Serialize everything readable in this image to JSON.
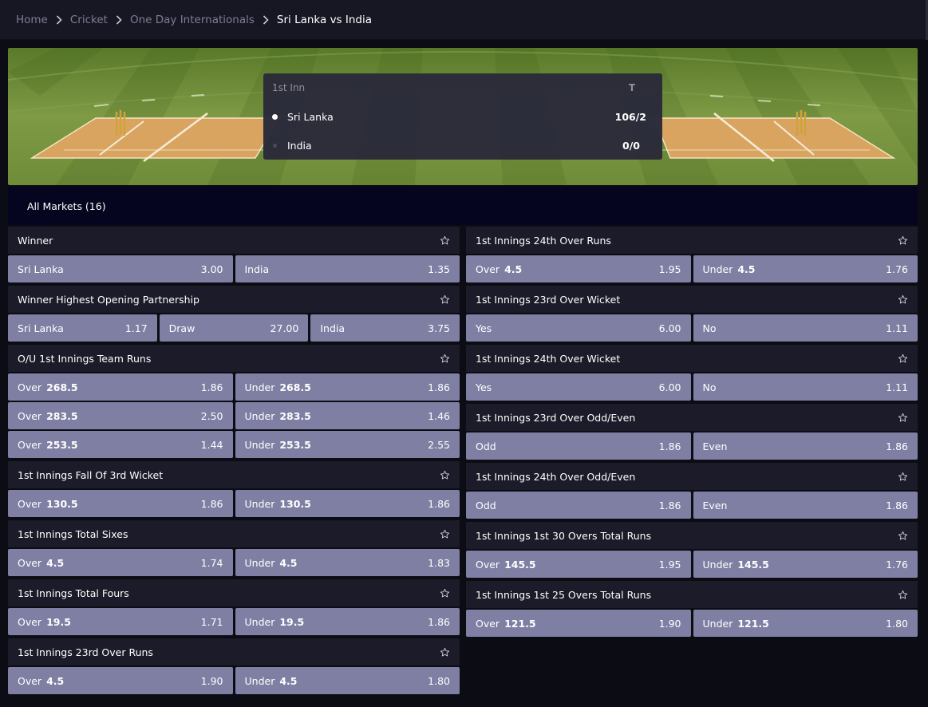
{
  "breadcrumb": {
    "items": [
      "Home",
      "Cricket",
      "One Day Internationals",
      "Sri Lanka vs India"
    ]
  },
  "scoreboard": {
    "innings_label": "1st Inn",
    "total_label": "T",
    "teams": [
      {
        "name": "Sri Lanka",
        "score": "106/2",
        "batting": true
      },
      {
        "name": "India",
        "score": "0/0",
        "batting": false
      }
    ]
  },
  "tabs": {
    "all_markets": "All Markets (16)"
  },
  "markets_left": [
    {
      "title": "Winner",
      "rows": [
        [
          {
            "label": "Sri Lanka",
            "line": "",
            "price": "3.00"
          },
          {
            "label": "India",
            "line": "",
            "price": "1.35"
          }
        ]
      ]
    },
    {
      "title": "Winner Highest Opening Partnership",
      "rows": [
        [
          {
            "label": "Sri Lanka",
            "line": "",
            "price": "1.17"
          },
          {
            "label": "Draw",
            "line": "",
            "price": "27.00"
          },
          {
            "label": "India",
            "line": "",
            "price": "3.75"
          }
        ]
      ]
    },
    {
      "title": "O/U 1st Innings Team Runs",
      "rows": [
        [
          {
            "label": "Over",
            "line": "268.5",
            "price": "1.86"
          },
          {
            "label": "Under",
            "line": "268.5",
            "price": "1.86"
          }
        ],
        [
          {
            "label": "Over",
            "line": "283.5",
            "price": "2.50"
          },
          {
            "label": "Under",
            "line": "283.5",
            "price": "1.46"
          }
        ],
        [
          {
            "label": "Over",
            "line": "253.5",
            "price": "1.44"
          },
          {
            "label": "Under",
            "line": "253.5",
            "price": "2.55"
          }
        ]
      ]
    },
    {
      "title": "1st Innings Fall Of 3rd Wicket",
      "rows": [
        [
          {
            "label": "Over",
            "line": "130.5",
            "price": "1.86"
          },
          {
            "label": "Under",
            "line": "130.5",
            "price": "1.86"
          }
        ]
      ]
    },
    {
      "title": "1st Innings Total Sixes",
      "rows": [
        [
          {
            "label": "Over",
            "line": "4.5",
            "price": "1.74"
          },
          {
            "label": "Under",
            "line": "4.5",
            "price": "1.83"
          }
        ]
      ]
    },
    {
      "title": "1st Innings Total Fours",
      "rows": [
        [
          {
            "label": "Over",
            "line": "19.5",
            "price": "1.71"
          },
          {
            "label": "Under",
            "line": "19.5",
            "price": "1.86"
          }
        ]
      ]
    },
    {
      "title": "1st Innings 23rd Over Runs",
      "rows": [
        [
          {
            "label": "Over",
            "line": "4.5",
            "price": "1.90"
          },
          {
            "label": "Under",
            "line": "4.5",
            "price": "1.80"
          }
        ]
      ]
    }
  ],
  "markets_right": [
    {
      "title": "1st Innings 24th Over Runs",
      "rows": [
        [
          {
            "label": "Over",
            "line": "4.5",
            "price": "1.95"
          },
          {
            "label": "Under",
            "line": "4.5",
            "price": "1.76"
          }
        ]
      ]
    },
    {
      "title": "1st Innings 23rd Over Wicket",
      "rows": [
        [
          {
            "label": "Yes",
            "line": "",
            "price": "6.00"
          },
          {
            "label": "No",
            "line": "",
            "price": "1.11"
          }
        ]
      ]
    },
    {
      "title": "1st Innings 24th Over Wicket",
      "rows": [
        [
          {
            "label": "Yes",
            "line": "",
            "price": "6.00"
          },
          {
            "label": "No",
            "line": "",
            "price": "1.11"
          }
        ]
      ]
    },
    {
      "title": "1st Innings 23rd Over Odd/Even",
      "rows": [
        [
          {
            "label": "Odd",
            "line": "",
            "price": "1.86"
          },
          {
            "label": "Even",
            "line": "",
            "price": "1.86"
          }
        ]
      ]
    },
    {
      "title": "1st Innings 24th Over Odd/Even",
      "rows": [
        [
          {
            "label": "Odd",
            "line": "",
            "price": "1.86"
          },
          {
            "label": "Even",
            "line": "",
            "price": "1.86"
          }
        ]
      ]
    },
    {
      "title": "1st Innings 1st 30 Overs Total Runs",
      "rows": [
        [
          {
            "label": "Over",
            "line": "145.5",
            "price": "1.95"
          },
          {
            "label": "Under",
            "line": "145.5",
            "price": "1.76"
          }
        ]
      ]
    },
    {
      "title": "1st Innings 1st 25 Overs Total Runs",
      "rows": [
        [
          {
            "label": "Over",
            "line": "121.5",
            "price": "1.90"
          },
          {
            "label": "Under",
            "line": "121.5",
            "price": "1.80"
          }
        ]
      ]
    }
  ],
  "colors": {
    "page_bg": "#0c0c14",
    "header_bg": "#171724",
    "market_head_bg": "#1b1b29",
    "odd_button_bg": "#7f7fa4",
    "tabbar_bg": "#05051f",
    "scoreboard_bg": "#2a2a3a",
    "pitch": "#d9a15a",
    "grass": "#7a9a3e"
  },
  "icons": {
    "breadcrumb_separator": "chevron-right-icon",
    "favorite": "star-outline-icon",
    "batting_indicator": "dot-icon"
  }
}
